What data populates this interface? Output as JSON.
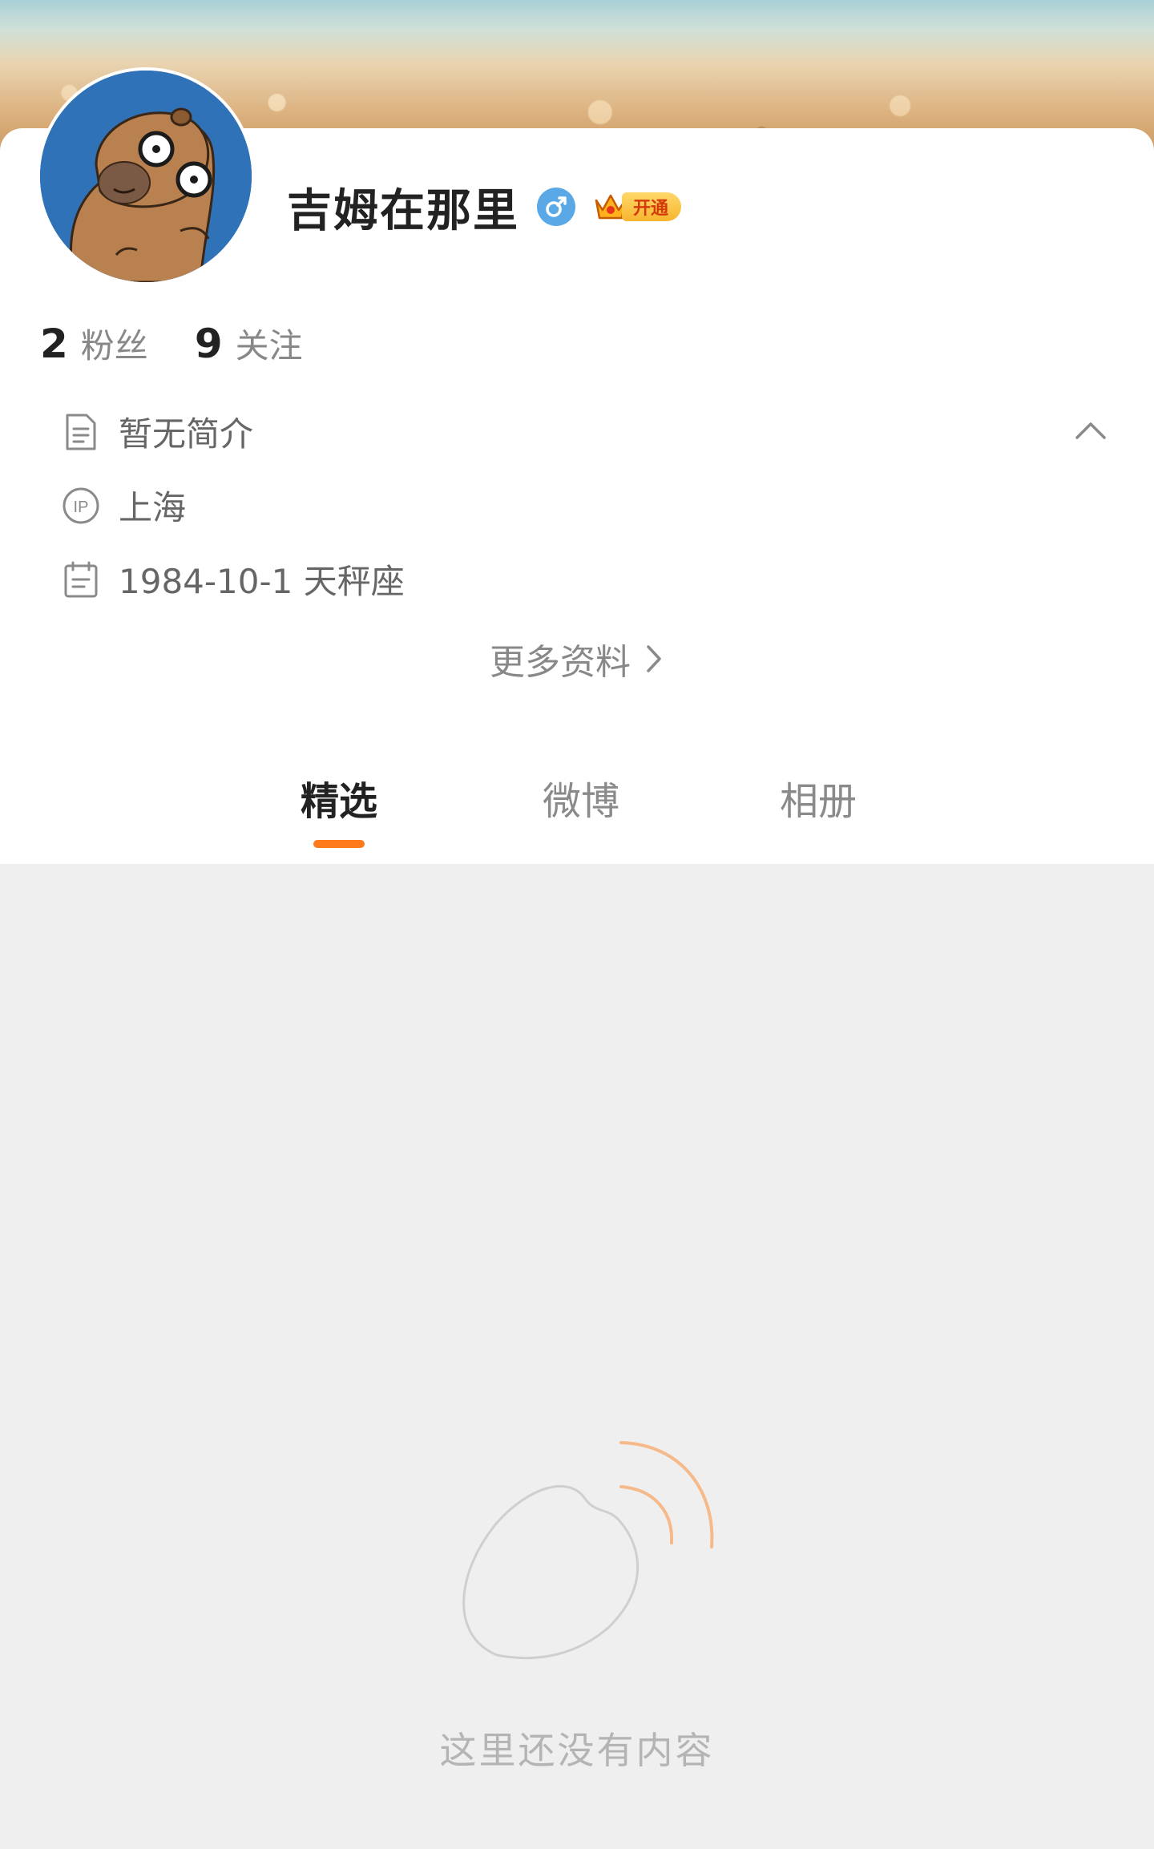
{
  "profile": {
    "name": "吉姆在那里",
    "vip_label": "开通",
    "stats": [
      {
        "value": "2",
        "label": "粉丝"
      },
      {
        "value": "9",
        "label": "关注"
      }
    ],
    "info": {
      "bio": "暂无简介",
      "ip": "上海",
      "birthday": "1984-10-1 天秤座"
    },
    "more_label": "更多资料"
  },
  "tabs": [
    {
      "label": "精选",
      "active": true
    },
    {
      "label": "微博",
      "active": false
    },
    {
      "label": "相册",
      "active": false
    }
  ],
  "empty": {
    "text": "这里还没有内容"
  },
  "colors": {
    "accent": "#ff7a1a",
    "gender": "#5aa9e6",
    "vip": "#f7b52e",
    "avatar_bg": "#2f72b8",
    "content_bg": "#efefef"
  },
  "icons": {
    "gender": "male-icon",
    "bio": "document-icon",
    "ip": "ip-location-icon",
    "birthday": "calendar-icon",
    "collapse": "chevron-up-icon",
    "more": "chevron-right-icon"
  }
}
